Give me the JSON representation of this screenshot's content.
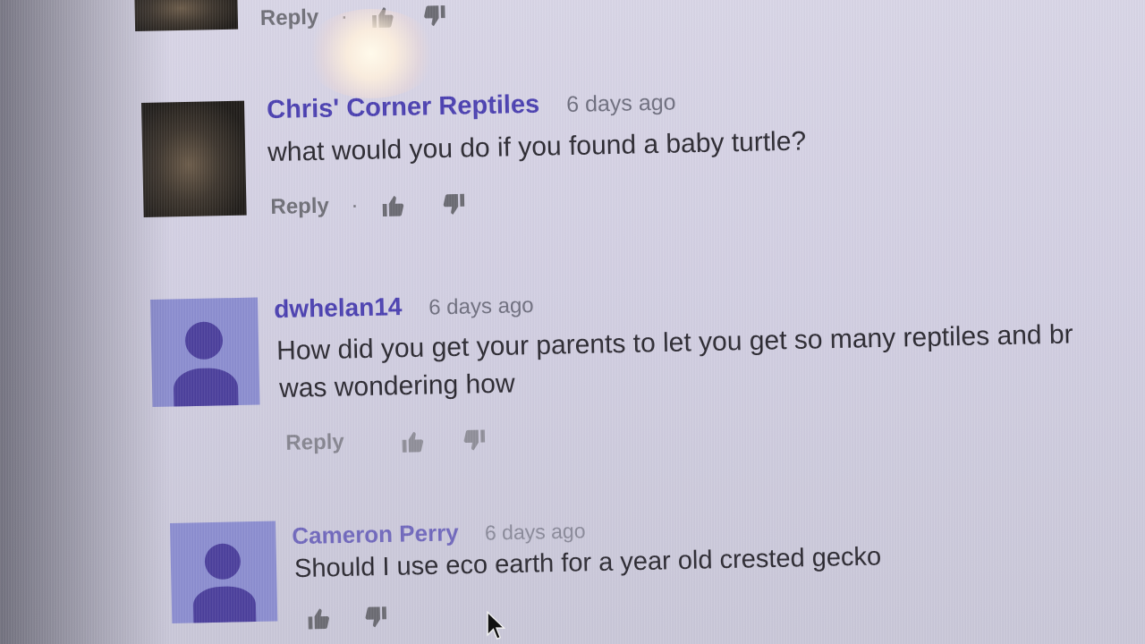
{
  "comments": [
    {
      "author": "",
      "time": "",
      "text": "",
      "reply_label": "Reply"
    },
    {
      "author": "Chris' Corner Reptiles",
      "time": "6 days ago",
      "text": "what would you do if you found a baby turtle?",
      "reply_label": "Reply"
    },
    {
      "author": "dwhelan14",
      "time": "6 days ago",
      "text_line1": "How did you get your parents to let you get so many reptiles and br",
      "text_line2": "was wondering how",
      "reply_label": "Reply"
    },
    {
      "author": "Cameron Perry",
      "time": "6 days ago",
      "text": "Should I use eco earth for a year old crested gecko"
    }
  ],
  "separator": "·",
  "icons": {
    "like": "thumbs-up-icon",
    "dislike": "thumbs-down-icon",
    "cursor": "mouse-pointer-icon"
  },
  "colors": {
    "author": "#4a3fb0",
    "timestamp": "#6e6e7e",
    "text": "#2a2830",
    "default_avatar_bg": "#8b8dd0",
    "default_avatar_figure": "#4b3f9c"
  }
}
